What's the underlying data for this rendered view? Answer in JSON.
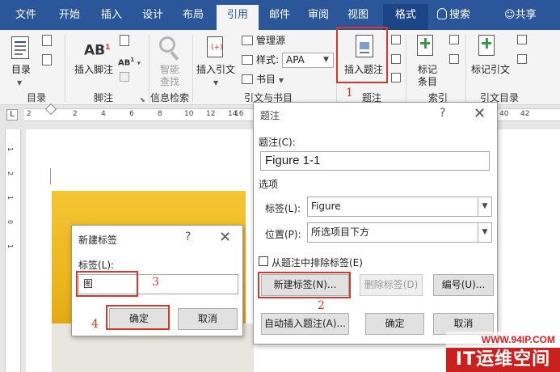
{
  "tabs": [
    {
      "label": "文件",
      "key": "file"
    },
    {
      "label": "开始",
      "key": "home"
    },
    {
      "label": "插入",
      "key": "insert"
    },
    {
      "label": "设计",
      "key": "design"
    },
    {
      "label": "布局",
      "key": "layout"
    },
    {
      "label": "引用",
      "key": "references"
    },
    {
      "label": "邮件",
      "key": "mailings"
    },
    {
      "label": "审阅",
      "key": "review"
    },
    {
      "label": "视图",
      "key": "view"
    },
    {
      "label": "格式",
      "key": "format"
    }
  ],
  "search_label": "搜索",
  "share_label": "共享",
  "ribbon": {
    "toc": {
      "button": "目录",
      "group": "目录"
    },
    "footnotes": {
      "insert_footnote": "插入脚注",
      "ab_label": "AB",
      "ab_super": "1",
      "ab_small": "AB",
      "ab_small_sup": "1",
      "group": "脚注"
    },
    "research": {
      "smart_lookup_1": "智能",
      "smart_lookup_2": "查找",
      "group": "信息检索"
    },
    "citations": {
      "insert_citation": "插入引文",
      "manage_sources": "管理源",
      "style_label": "样式:",
      "style_value": "APA",
      "bibliography": "书目",
      "group": "引文与书目"
    },
    "captions": {
      "insert_caption": "插入题注",
      "group": "题注"
    },
    "index": {
      "mark_entry_1": "标记",
      "mark_entry_2": "条目",
      "group": "索引"
    },
    "toa": {
      "mark_citation": "标记引文",
      "group": "引文目录"
    }
  },
  "ruler": {
    "h_numbers": [
      "2",
      "2",
      "4",
      "6",
      "8",
      "10",
      "12",
      "14",
      "16",
      "40",
      "42"
    ],
    "v_numbers": [
      "1",
      "2",
      "1",
      "0",
      "1"
    ],
    "corner_label": "L"
  },
  "caption_dialog": {
    "title": "题注",
    "help": "?",
    "close": "✕",
    "caption_label": "题注(C):",
    "caption_value": "Figure 1-1",
    "options_label": "选项",
    "label_label": "标签(L):",
    "label_value": "Figure",
    "position_label": "位置(P):",
    "position_value": "所选项目下方",
    "exclude_label": "从题注中排除标签(E)",
    "new_label_btn": "新建标签(N)...",
    "delete_label_btn": "删除标签(D)",
    "numbering_btn": "编号(U)...",
    "autocaption_btn": "自动插入题注(A)...",
    "ok_btn": "确定",
    "cancel_btn": "取消"
  },
  "new_label_dialog": {
    "title": "新建标签",
    "help": "?",
    "close": "✕",
    "label_label": "标签(L):",
    "label_value": "图",
    "ok_btn": "确定",
    "cancel_btn": "取消"
  },
  "steps": [
    "1",
    "2",
    "3",
    "4"
  ],
  "watermark": {
    "url": "WWW.94IP.COM",
    "brand": "IT运维空间"
  },
  "colors": {
    "ribbon_blue": "#2b579a",
    "highlight_red": "#d9352a",
    "photo_yellow": "#f4c534"
  }
}
